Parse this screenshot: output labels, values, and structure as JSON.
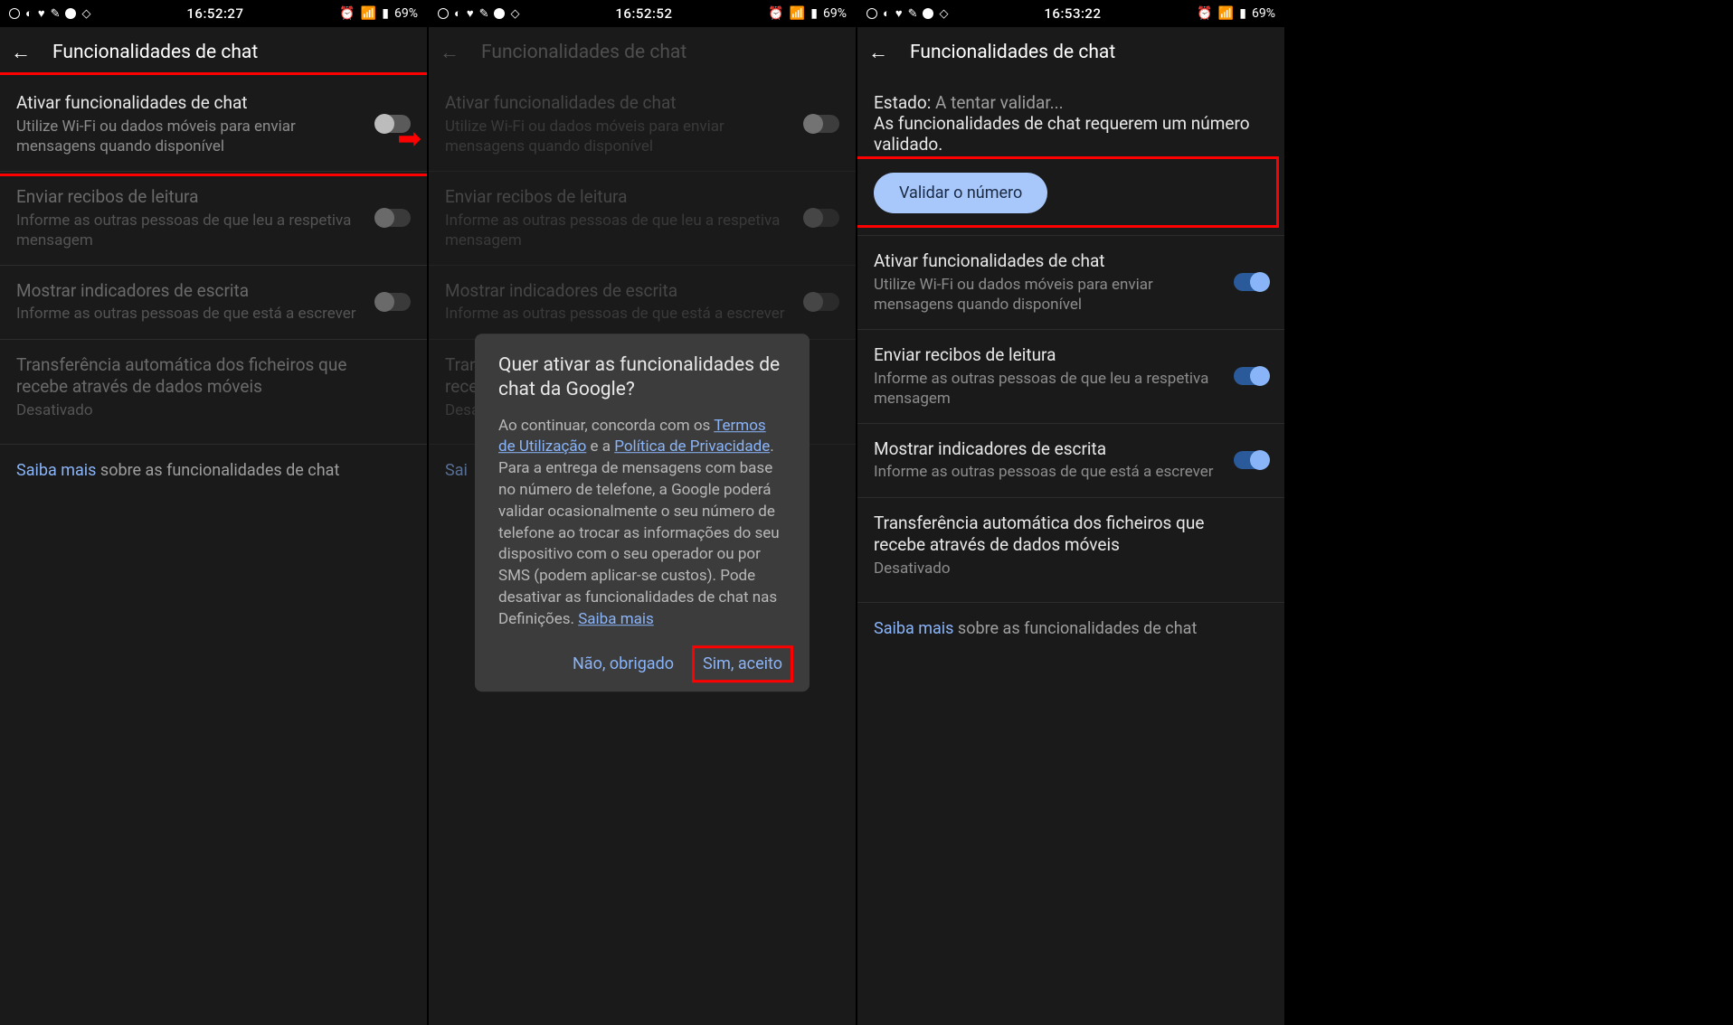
{
  "screen1": {
    "status": {
      "time": "16:52:27",
      "battery": "69%"
    },
    "title": "Funcionalidades de chat",
    "rows": {
      "activate": {
        "title": "Ativar funcionalidades de chat",
        "sub": "Utilize Wi-Fi ou dados móveis para enviar mensagens quando disponível"
      },
      "receipts": {
        "title": "Enviar recibos de leitura",
        "sub": "Informe as outras pessoas de que leu a respetiva mensagem"
      },
      "typing": {
        "title": "Mostrar indicadores de escrita",
        "sub": "Informe as outras pessoas de que está a escrever"
      },
      "auto": {
        "title": "Transferência automática dos ficheiros que recebe através de dados móveis",
        "sub": "Desativado"
      }
    },
    "learn": {
      "link": "Saiba mais",
      "rest": " sobre as funcionalidades de chat"
    }
  },
  "screen2": {
    "status": {
      "time": "16:52:52",
      "battery": "69%"
    },
    "title": "Funcionalidades de chat",
    "dialog": {
      "title": "Quer ativar as funcionalidades de chat da Google?",
      "pre": "Ao continuar, concorda com os ",
      "terms": "Termos de Utilização",
      "mid": " e a ",
      "privacy": "Política de Privacidade",
      "post": ". Para a entrega de mensagens com base no número de telefone, a Google poderá validar ocasionalmente o seu número de telefone ao trocar as informações do seu dispositivo com o seu operador ou por SMS (podem aplicar-se custos). Pode desativar as funcionalidades de chat nas Definições. ",
      "learn": "Saiba mais",
      "no": "Não, obrigado",
      "yes": "Sim, aceito"
    },
    "learn": {
      "link": "Sai"
    }
  },
  "screen3": {
    "status": {
      "time": "16:53:22",
      "battery": "69%"
    },
    "title": "Funcionalidades de chat",
    "state": {
      "label": "Estado: ",
      "value": "A tentar validar...",
      "msg": "As funcionalidades de chat requerem um número validado."
    },
    "validate": "Validar o número",
    "rows": {
      "activate": {
        "title": "Ativar funcionalidades de chat",
        "sub": "Utilize Wi-Fi ou dados móveis para enviar mensagens quando disponível"
      },
      "receipts": {
        "title": "Enviar recibos de leitura",
        "sub": "Informe as outras pessoas de que leu a respetiva mensagem"
      },
      "typing": {
        "title": "Mostrar indicadores de escrita",
        "sub": "Informe as outras pessoas de que está a escrever"
      },
      "auto": {
        "title": "Transferência automática dos ficheiros que recebe através de dados móveis",
        "sub": "Desativado"
      }
    },
    "learn": {
      "link": "Saiba mais",
      "rest": " sobre as funcionalidades de chat"
    }
  }
}
